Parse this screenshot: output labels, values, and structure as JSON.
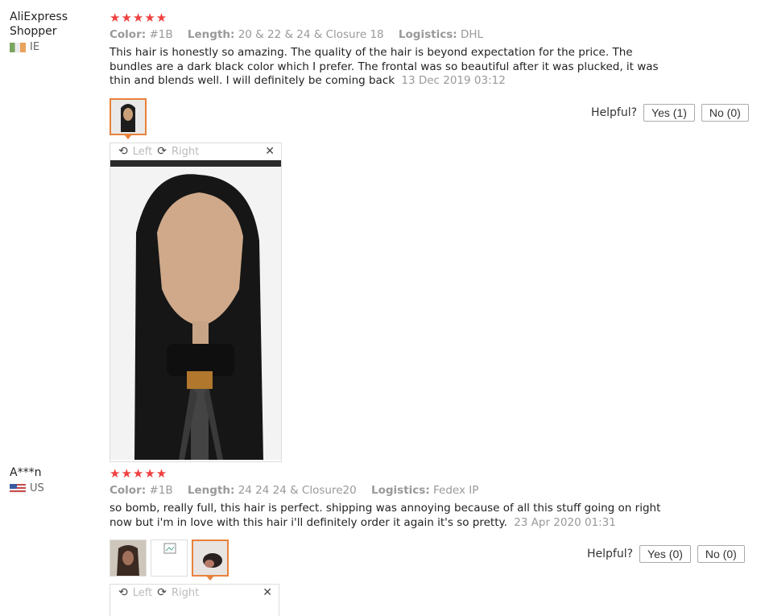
{
  "reviews": [
    {
      "user": "AliExpress Shopper",
      "country": "IE",
      "flag_icon": "ireland-flag-icon",
      "stars": "★★★★★",
      "color_label": "Color:",
      "color_value": "#1B",
      "length_label": "Length:",
      "length_value": "20 & 22 & 24 & Closure 18",
      "logistics_label": "Logistics:",
      "logistics_value": "DHL",
      "text": "This hair is honestly so amazing. The quality of the hair is beyond expectation for the price. The bundles are a dark black color which I prefer. The frontal was so beautiful after it was plucked, it was thin and blends well. I will definitely be coming back",
      "date": "13 Dec 2019 03:12",
      "helpful_label": "Helpful?",
      "yes_label": "Yes (1)",
      "no_label": "No (0)",
      "viewer": {
        "left_label": "Left",
        "right_label": "Right",
        "close": "✕"
      }
    },
    {
      "user": "A***n",
      "country": "US",
      "flag_icon": "usa-flag-icon",
      "stars": "★★★★★",
      "color_label": "Color:",
      "color_value": "#1B",
      "length_label": "Length:",
      "length_value": "24 24 24 & Closure20",
      "logistics_label": "Logistics:",
      "logistics_value": "Fedex IP",
      "text": "so bomb, really full, this hair is perfect. shipping was annoying because of all this stuff going on right now but i'm in love with this hair i'll definitely order it again it's so pretty.",
      "date": "23 Apr 2020 01:31",
      "helpful_label": "Helpful?",
      "yes_label": "Yes (0)",
      "no_label": "No (0)",
      "viewer": {
        "left_label": "Left",
        "right_label": "Right",
        "close": "✕"
      }
    }
  ],
  "colors": {
    "star": "#ef3f3f",
    "accent": "#e8823a",
    "muted": "#999999"
  }
}
